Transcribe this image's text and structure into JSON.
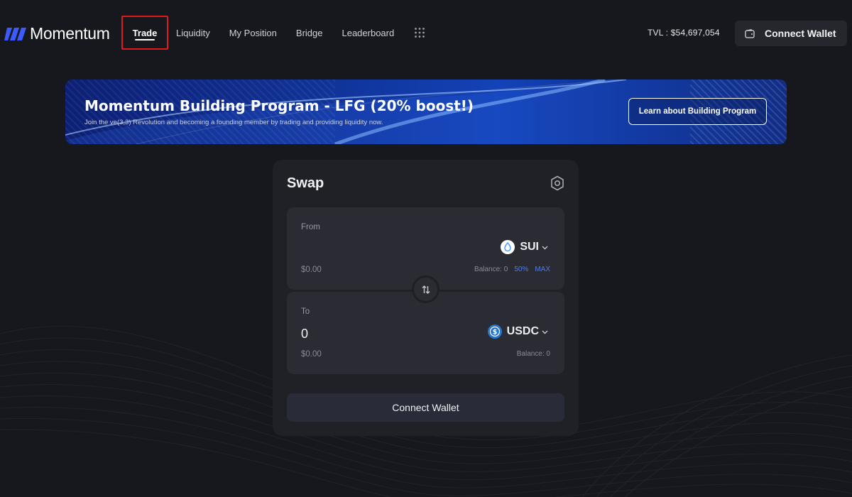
{
  "brand": {
    "name": "Momentum",
    "logo_icon": "momentum-logo-icon",
    "accent": "#3b5bff"
  },
  "nav": {
    "items": [
      {
        "label": "Trade",
        "active": true
      },
      {
        "label": "Liquidity"
      },
      {
        "label": "My Position"
      },
      {
        "label": "Bridge"
      },
      {
        "label": "Leaderboard"
      }
    ],
    "more_icon": "grid-dots-icon"
  },
  "header": {
    "tvl_text": "TVL : $54,697,054",
    "connect_label": "Connect Wallet",
    "wallet_icon": "wallet-icon"
  },
  "banner": {
    "title": "Momentum Building Program - LFG (20% boost!)",
    "subtitle": "Join the ve(3,3) Revolution and becoming a founding member by trading and providing liquidity now.",
    "button_label": "Learn about Building Program"
  },
  "swap": {
    "title": "Swap",
    "settings_icon": "settings-hexagon-icon",
    "from": {
      "label": "From",
      "value": "",
      "token": "SUI",
      "token_icon": "sui-droplet-icon",
      "usd": "$0.00",
      "balance": "Balance: 0",
      "quick_half": "50%",
      "quick_max": "MAX"
    },
    "switch_icon": "swap-arrows-icon",
    "to": {
      "label": "To",
      "value": "0",
      "token": "USDC",
      "token_icon": "usdc-coin-icon",
      "usd": "$0.00",
      "balance": "Balance: 0"
    },
    "connect_label": "Connect Wallet"
  }
}
